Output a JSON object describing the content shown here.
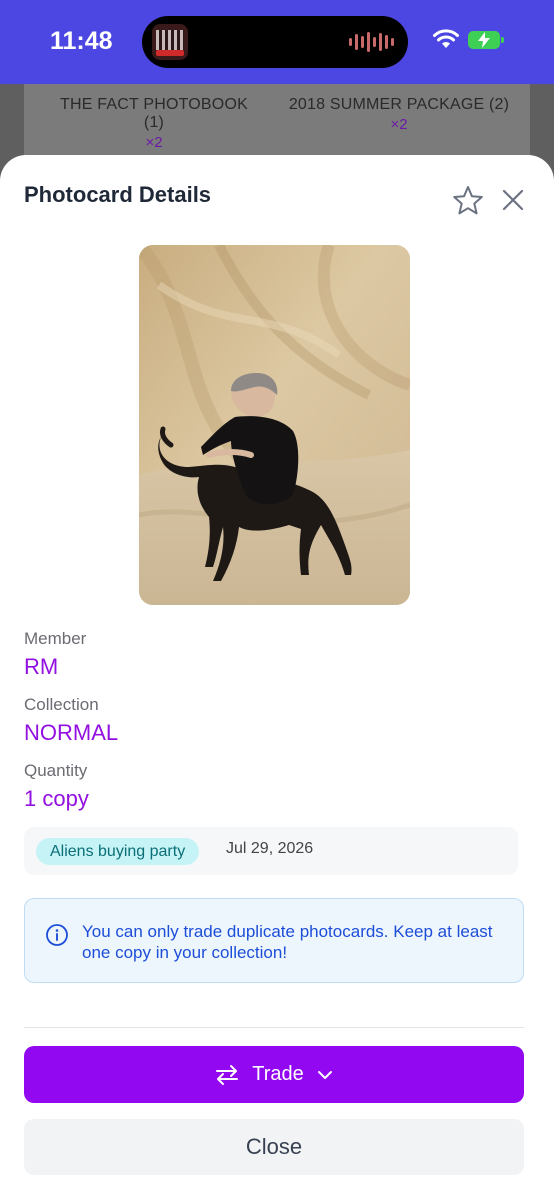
{
  "status_bar": {
    "time": "11:48"
  },
  "background": {
    "items": [
      {
        "title": "THE FACT PHOTOBOOK (1)",
        "count": "×2"
      },
      {
        "title": "2018 SUMMER PACKAGE (2)",
        "count": "×2"
      }
    ]
  },
  "modal": {
    "title": "Photocard Details",
    "fields": [
      {
        "label": "Member",
        "value": "RM"
      },
      {
        "label": "Collection",
        "value": "NORMAL"
      },
      {
        "label": "Quantity",
        "value": "1 copy"
      }
    ],
    "tag": {
      "badge": "Aliens buying party",
      "date": "Jul 29, 2026"
    },
    "info": "You can only trade duplicate photocards. Keep at least one copy in your collection!",
    "trade_label": "Trade",
    "close_label": "Close"
  },
  "colors": {
    "accent": "#9208f0",
    "value_text": "#9210e0",
    "status_bar": "#4c47e3"
  },
  "icons": [
    "star-icon",
    "close-icon",
    "info-icon",
    "swap-icon",
    "chevron-down-icon",
    "wifi-icon",
    "battery-charging-icon"
  ]
}
